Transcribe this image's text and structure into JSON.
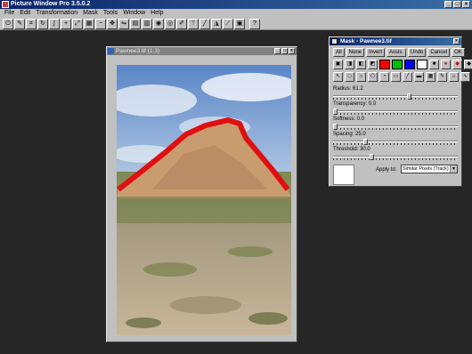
{
  "app": {
    "title": "Picture Window Pro 3.5.0.2"
  },
  "menu": [
    "File",
    "Edit",
    "Transformation",
    "Mask",
    "Tools",
    "Window",
    "Help"
  ],
  "toolbar_icons": [
    "power-icon",
    "pen-icon",
    "crop-icon",
    "rotate-icon",
    "curve-icon",
    "plus-icon",
    "resize-icon",
    "grid-icon",
    "minus-icon",
    "expand-icon",
    "flip-icon",
    "gradient-icon",
    "film-icon",
    "eye-icon",
    "lens-icon",
    "brush-icon",
    "magic-wand-icon",
    "marker-icon",
    "sharpen-icon",
    "eyedropper-icon",
    "stamp-icon",
    "help-icon"
  ],
  "image_window": {
    "title": "Pawnee3.tif (1:3)"
  },
  "mask_window": {
    "title": "Mask - Pawnee3.tif",
    "buttons": [
      "All",
      "None",
      "Invert",
      "Assis.",
      "Undo",
      "Cancel",
      "OK"
    ],
    "colors": {
      "red": "#ff0000",
      "green": "#00c000",
      "blue": "#0000ff",
      "white": "#ffffff"
    },
    "sliders": [
      {
        "label": "Radius: 61.2",
        "value": 61.2,
        "max": 100
      },
      {
        "label": "Transparency: 0.0",
        "value": 0.0,
        "max": 100
      },
      {
        "label": "Softness: 0.0",
        "value": 0.0,
        "max": 100
      },
      {
        "label": "Spacing: 25.0",
        "value": 25.0,
        "max": 100
      },
      {
        "label": "Threshold: 30.0",
        "value": 30.0,
        "max": 100
      }
    ],
    "apply_to_label": "Apply to:",
    "apply_to_value": "Similar Pixels (Track)"
  }
}
